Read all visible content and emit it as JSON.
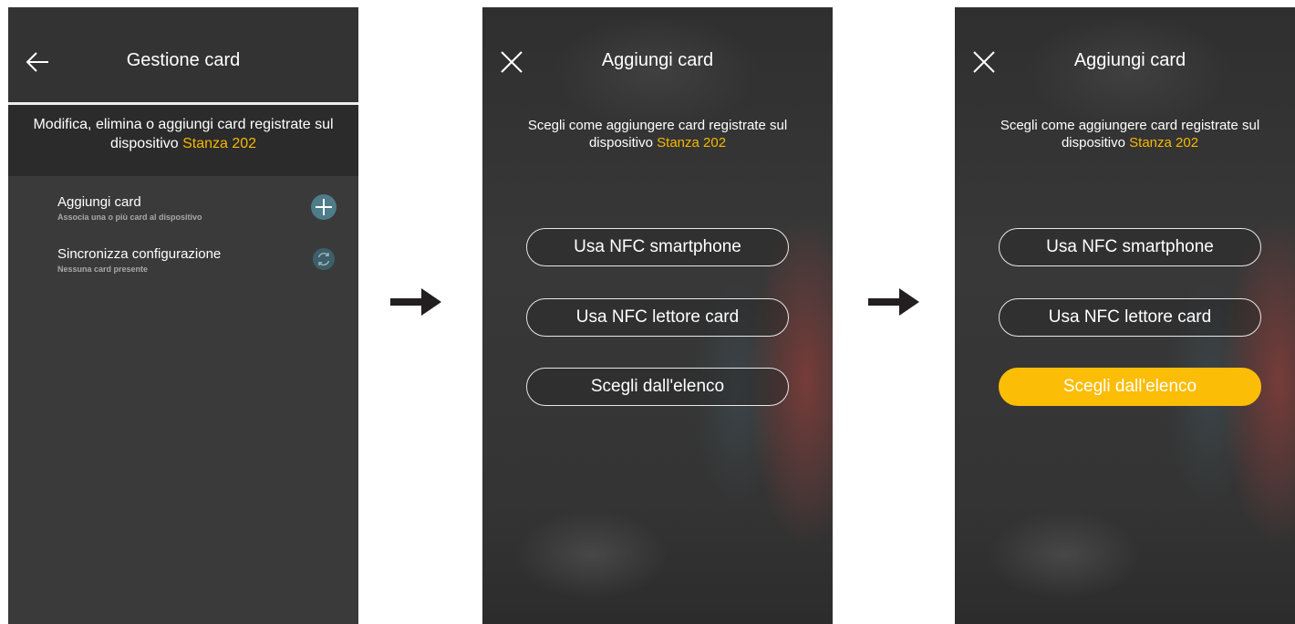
{
  "screen1": {
    "title": "Gestione card",
    "description_prefix": "Modifica, elimina o aggiungi card registrate sul dispositivo ",
    "device_name": "Stanza 202",
    "items": [
      {
        "title": "Aggiungi card",
        "subtitle": "Associa una o più card al dispositivo",
        "icon": "plus-icon"
      },
      {
        "title": "Sincronizza configurazione",
        "subtitle": "Nessuna card presente",
        "icon": "sync-icon"
      }
    ],
    "icons": {
      "back": "arrow-left-icon"
    }
  },
  "screen2": {
    "title": "Aggiungi card",
    "description_prefix": "Scegli come aggiungere card registrate sul dispositivo ",
    "device_name": "Stanza 202",
    "options": [
      "Usa NFC smartphone",
      "Usa NFC lettore card",
      "Scegli dall'elenco"
    ],
    "selected_option": null,
    "icons": {
      "close": "close-icon"
    }
  },
  "screen3": {
    "title": "Aggiungi card",
    "description_prefix": "Scegli come aggiungere card registrate sul dispositivo ",
    "device_name": "Stanza 202",
    "options": [
      "Usa NFC smartphone",
      "Usa NFC lettore card",
      "Scegli dall'elenco"
    ],
    "selected_option": "Scegli dall'elenco",
    "icons": {
      "close": "close-icon"
    }
  },
  "colors": {
    "accent": "#f5b800",
    "selected_button": "#fbbd06",
    "screen_background": "#323232",
    "icon_button": "#4e7c89"
  },
  "flow_arrows": [
    "arrow-right-icon",
    "arrow-right-icon"
  ]
}
